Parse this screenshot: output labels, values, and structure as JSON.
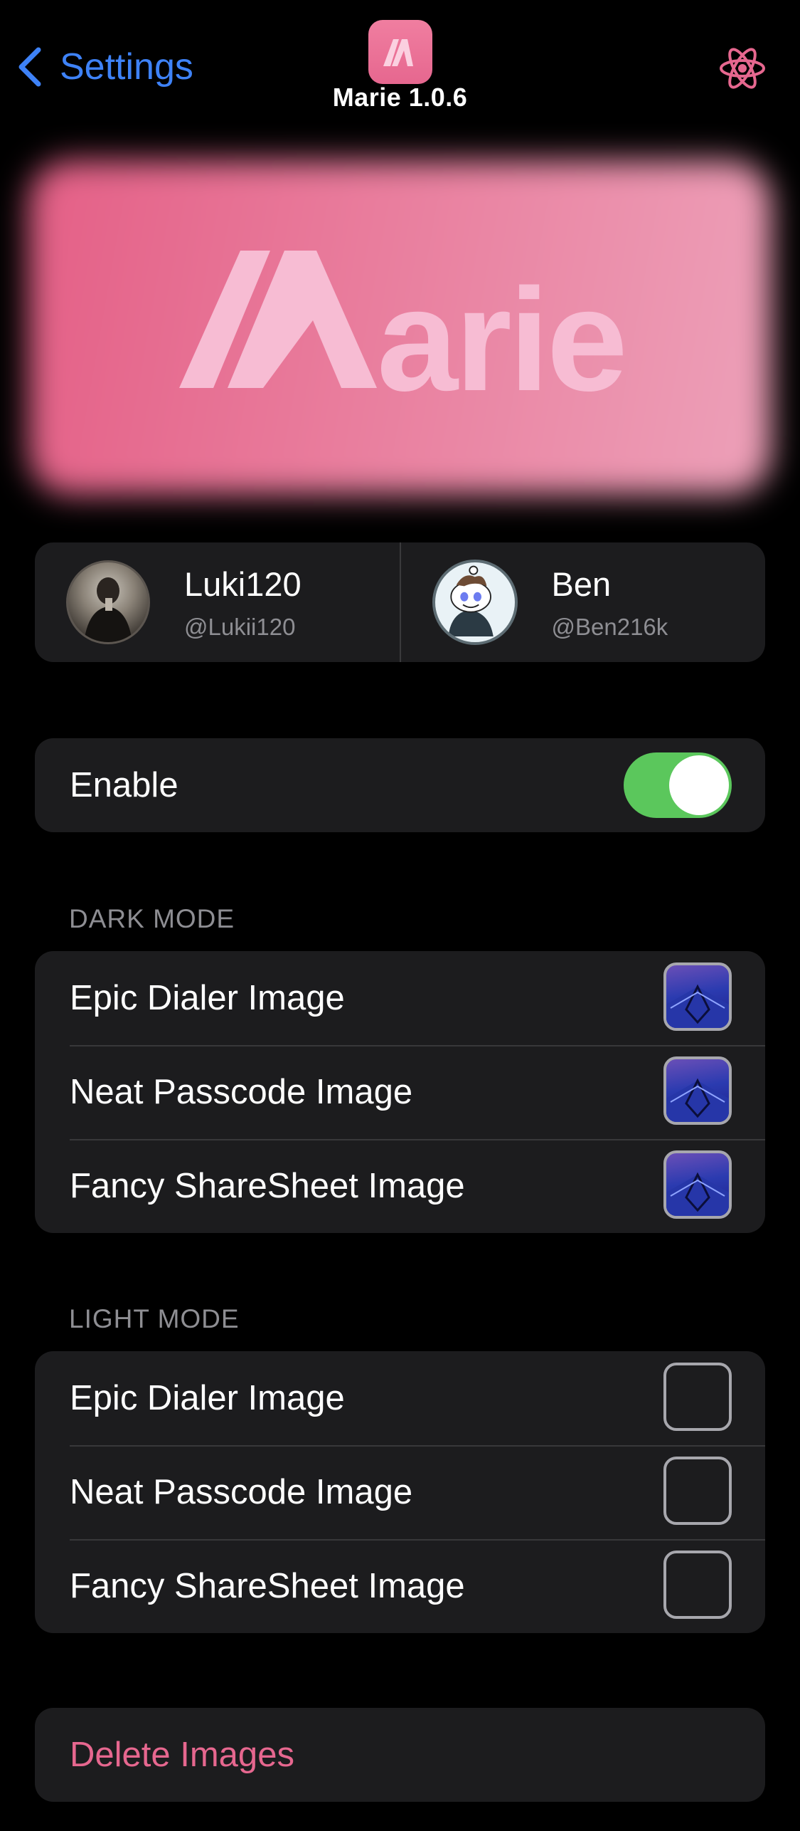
{
  "nav": {
    "back_label": "Settings",
    "title": "Marie 1.0.6",
    "accent": "#3e82f7"
  },
  "banner": {
    "logo_text": "arie",
    "colors": [
      "#e45f86",
      "#eda1b9"
    ]
  },
  "authors": [
    {
      "name": "Luki120",
      "handle": "@Lukii120"
    },
    {
      "name": "Ben",
      "handle": "@Ben216k"
    }
  ],
  "enable": {
    "label": "Enable",
    "on": true,
    "on_color": "#5bc75c"
  },
  "dark_mode": {
    "header": "DARK MODE",
    "items": [
      {
        "label": "Epic Dialer Image",
        "has_image": true
      },
      {
        "label": "Neat Passcode Image",
        "has_image": true
      },
      {
        "label": "Fancy ShareSheet Image",
        "has_image": true
      }
    ]
  },
  "light_mode": {
    "header": "LIGHT MODE",
    "items": [
      {
        "label": "Epic Dialer Image",
        "has_image": false
      },
      {
        "label": "Neat Passcode Image",
        "has_image": false
      },
      {
        "label": "Fancy ShareSheet Image",
        "has_image": false
      }
    ]
  },
  "delete": {
    "label": "Delete Images",
    "color": "#e6678f"
  }
}
